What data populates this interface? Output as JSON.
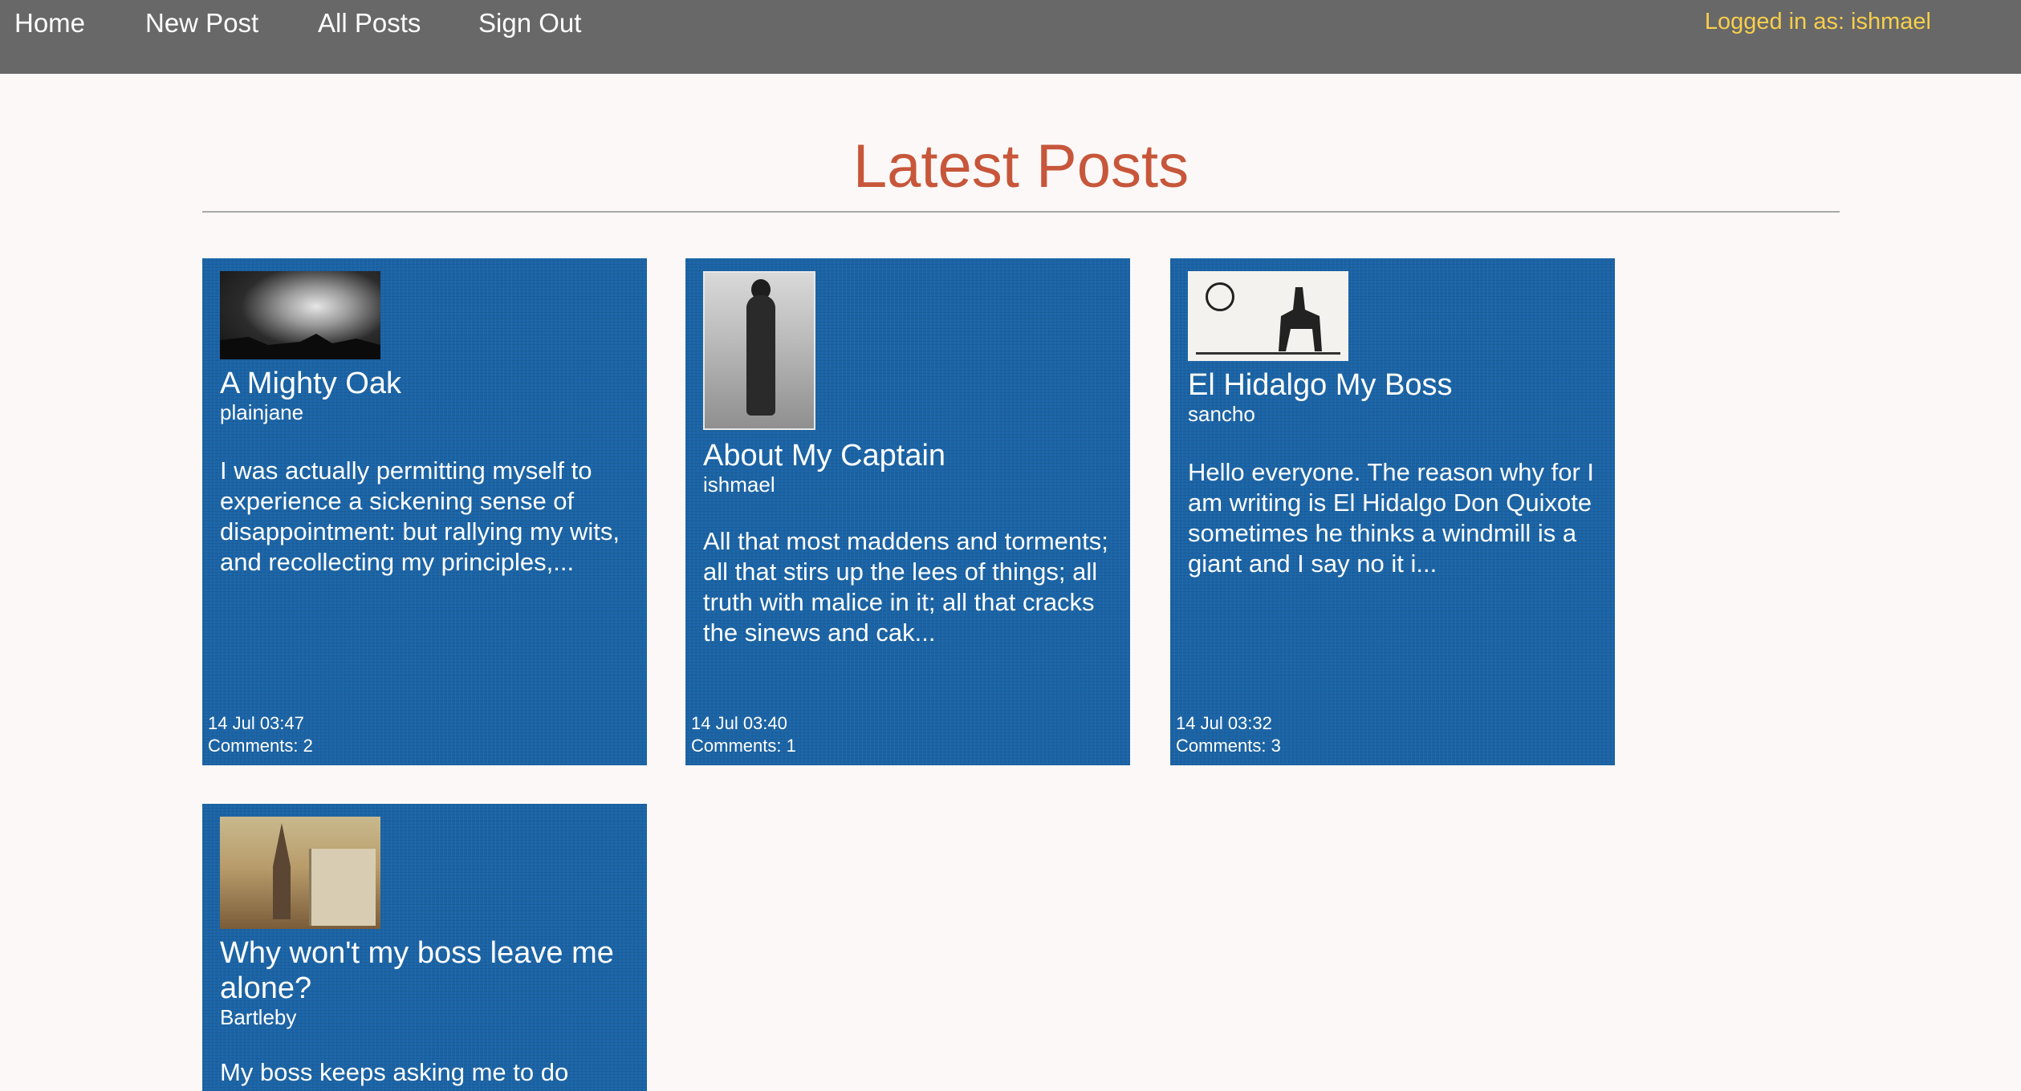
{
  "nav": {
    "home": "Home",
    "new_post": "New Post",
    "all_posts": "All Posts",
    "sign_out": "Sign Out",
    "login_status": "Logged in as: ishmael"
  },
  "colors": {
    "navbar": "#686868",
    "login_status": "#f7cf4c",
    "title": "#c7563a",
    "card": "#1b64a6",
    "background": "#fbf8f7"
  },
  "main": {
    "title": "Latest Posts"
  },
  "posts": [
    {
      "title": "A Mighty Oak",
      "author": "plainjane",
      "excerpt": "I was actually permitting myself to experience a sickening sense of disappointment: but rallying my wits, and recollecting my principles,...",
      "date": "14 Jul 03:47",
      "comments": "Comments: 2",
      "image": "storm-cloud-photo"
    },
    {
      "title": "About My Captain",
      "author": "ishmael",
      "excerpt": "All that most maddens and torments; all that stirs up the lees of things; all truth with malice in it; all that cracks the sinews and cak...",
      "date": "14 Jul 03:40",
      "comments": "Comments: 1",
      "image": "standing-man-photo"
    },
    {
      "title": "El Hidalgo My Boss",
      "author": "sancho",
      "excerpt": "Hello everyone. The reason why for I am writing is El Hidalgo Don Quixote sometimes he thinks a windmill is a giant and I say no it i...",
      "date": "14 Jul 03:32",
      "comments": "Comments: 3",
      "image": "don-quixote-sketch"
    },
    {
      "title": "Why won't my boss leave me alone?",
      "author": "Bartleby",
      "excerpt": "My boss keeps asking me to do",
      "image": "wall-street-painting"
    }
  ]
}
